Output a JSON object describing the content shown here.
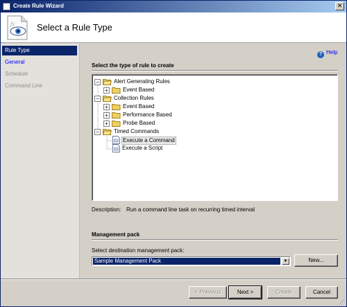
{
  "window": {
    "title": "Create Rule Wizard",
    "close_label": "✕"
  },
  "header": {
    "title": "Select a Rule Type"
  },
  "nav": {
    "items": [
      {
        "label": "Rule Type",
        "state": "active"
      },
      {
        "label": "General",
        "state": "link"
      },
      {
        "label": "Schedule",
        "state": "disabled"
      },
      {
        "label": "Command Line",
        "state": "disabled"
      }
    ]
  },
  "help": {
    "label": "Help",
    "icon_glyph": "?"
  },
  "rule_type": {
    "heading": "Select the type of rule to create",
    "tree": [
      {
        "label": "Alert Generating Rules",
        "kind": "folder",
        "expander": "−"
      },
      {
        "label": "Event Based",
        "kind": "folder",
        "expander": "+"
      },
      {
        "label": "Collection Rules",
        "kind": "folder",
        "expander": "−"
      },
      {
        "label": "Event Based",
        "kind": "folder",
        "expander": "+"
      },
      {
        "label": "Performance Based",
        "kind": "folder",
        "expander": "+"
      },
      {
        "label": "Probe Based",
        "kind": "folder",
        "expander": "+"
      },
      {
        "label": "Timed Commands",
        "kind": "folder",
        "expander": "−"
      },
      {
        "label": "Execute a Command",
        "kind": "item",
        "selected": true
      },
      {
        "label": "Execute a Script",
        "kind": "item"
      }
    ]
  },
  "description": {
    "label": "Description:",
    "text": "Run a command line task on recurring timed interval"
  },
  "management_pack": {
    "heading": "Management pack",
    "select_label": "Select destination management pack:",
    "selected_value": "Sample Management Pack",
    "new_button": "New..."
  },
  "buttons": {
    "previous": "< Previous",
    "next": "Next >",
    "create": "Create",
    "cancel": "Cancel"
  },
  "colors": {
    "titlebar": "#0a246a",
    "selection": "#0a246a",
    "link": "#0000ff",
    "face": "#d4d0c8"
  }
}
